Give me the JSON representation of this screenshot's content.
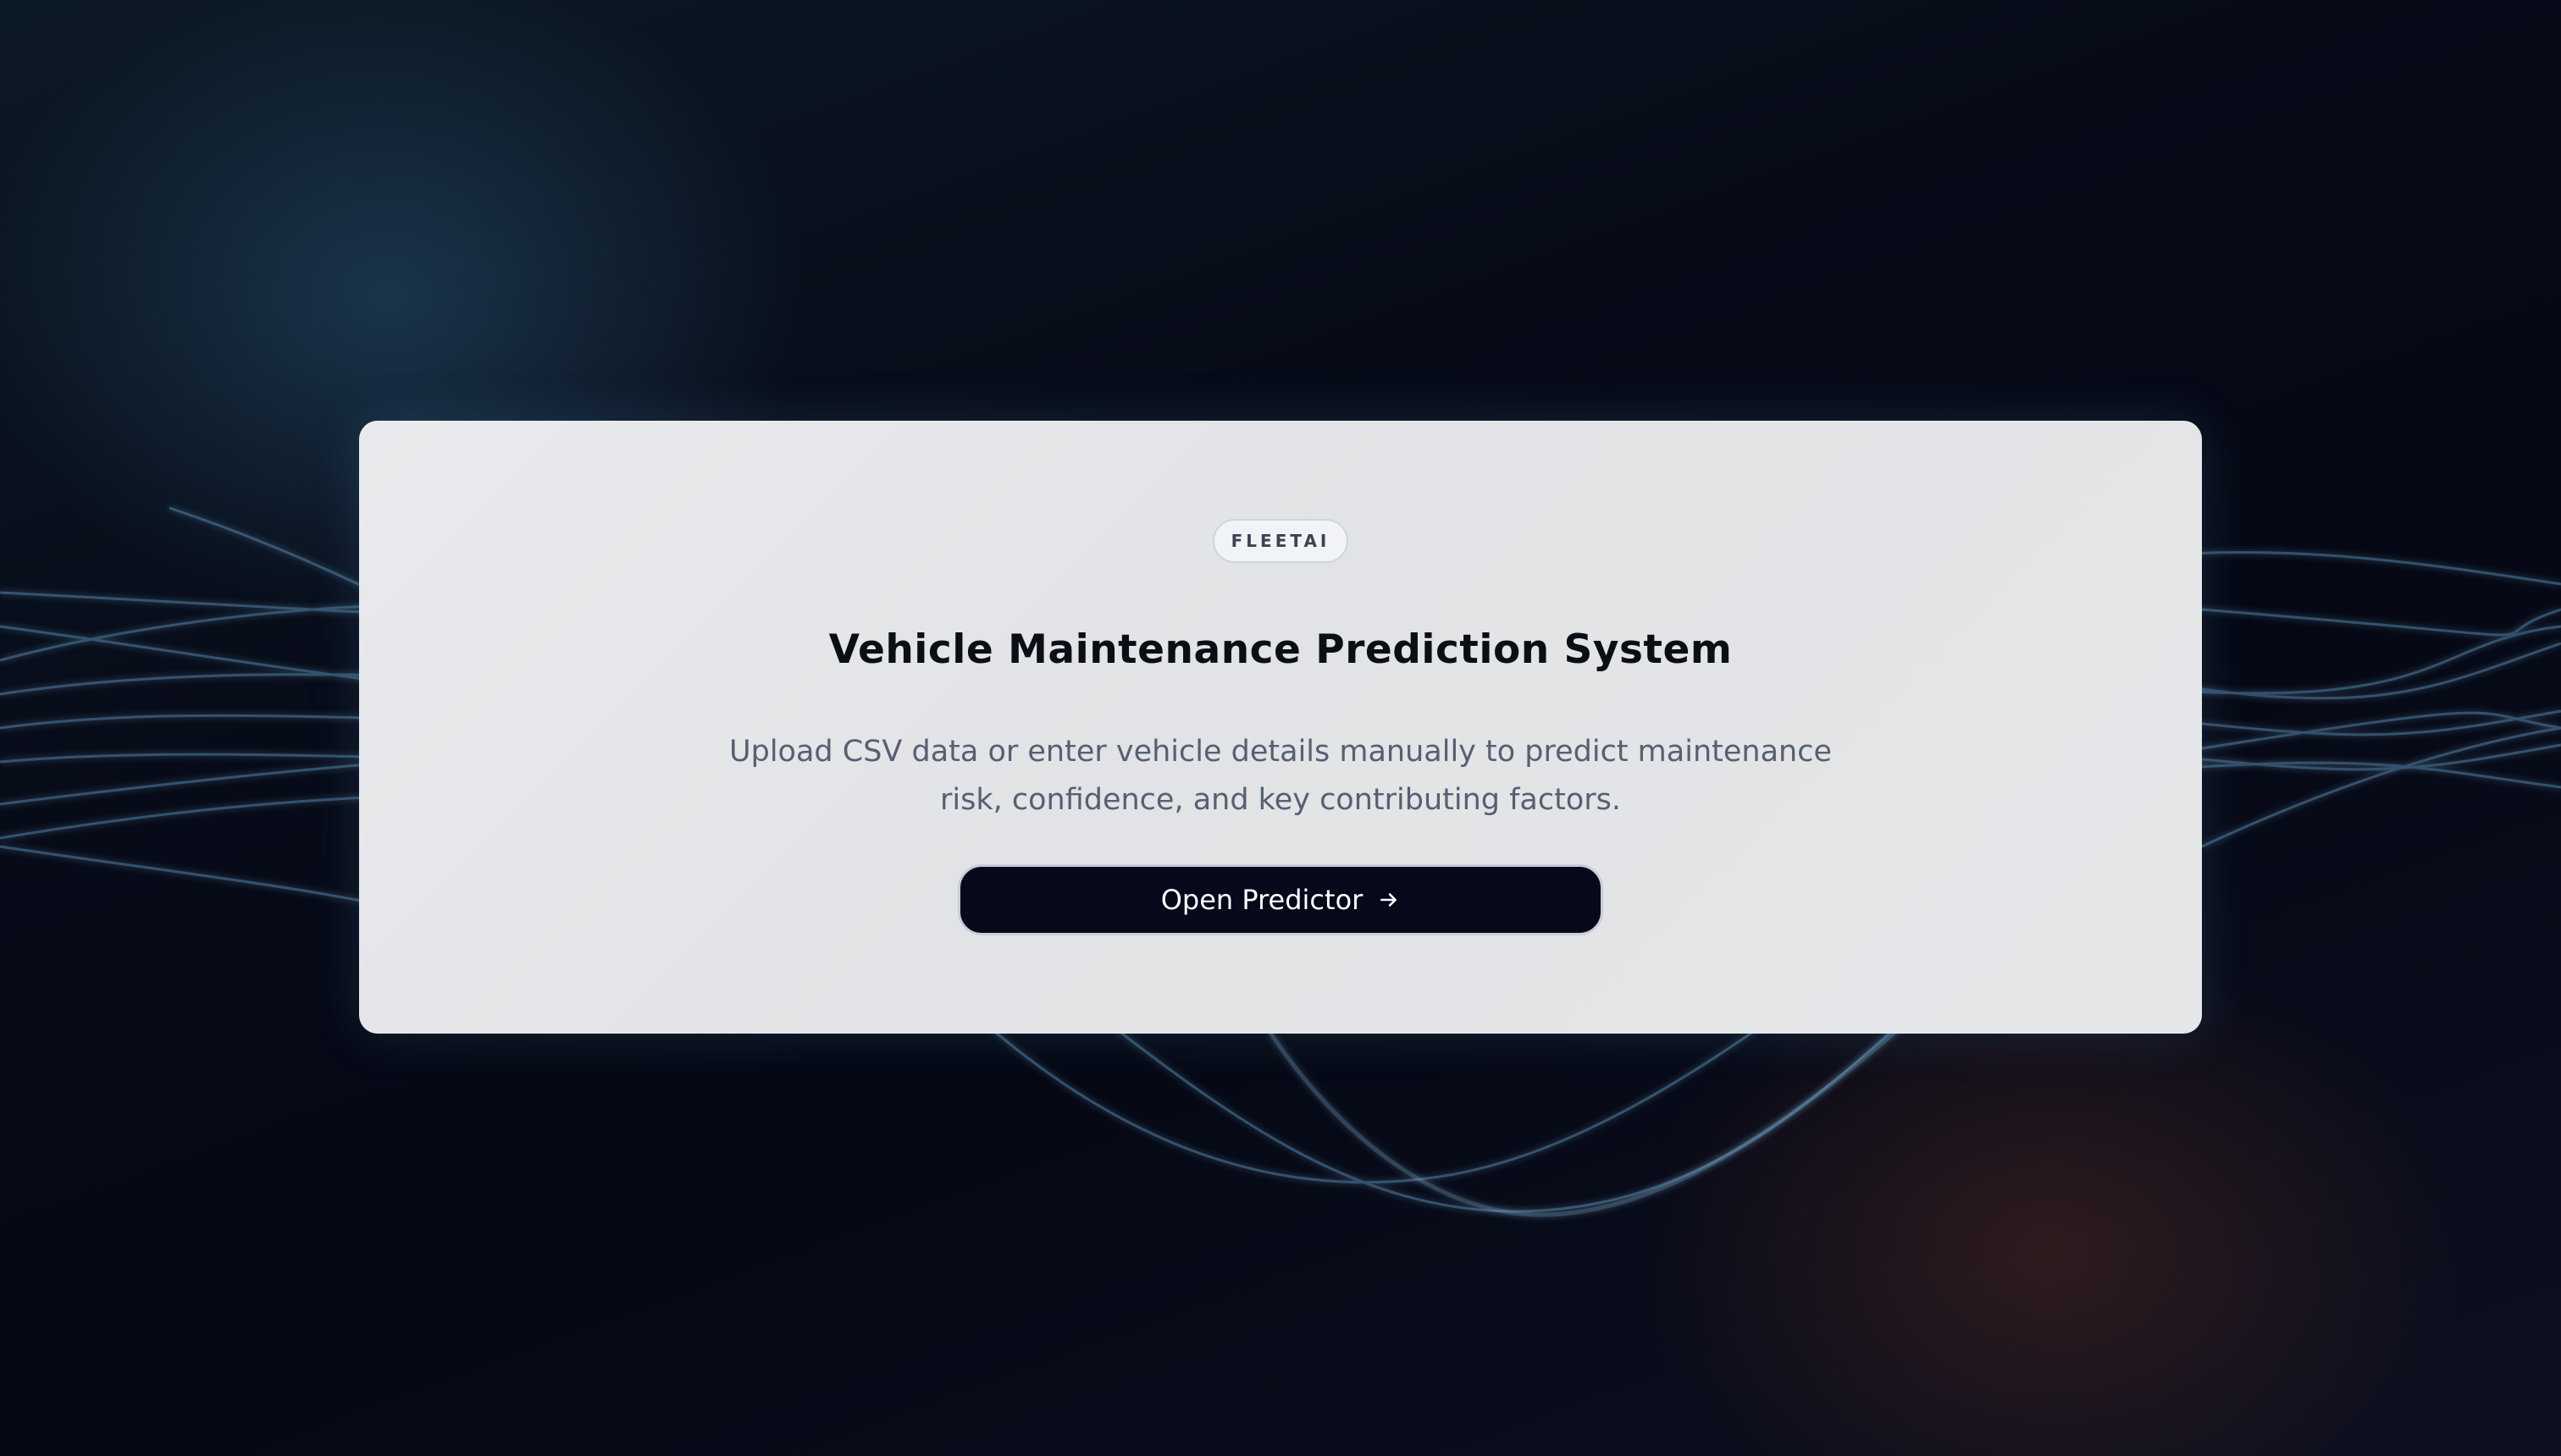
{
  "hero": {
    "badge": "FLEETAI",
    "title": "Vehicle Maintenance Prediction System",
    "subtitle": "Upload CSV data or enter vehicle details manually to predict maintenance risk, confidence, and key contributing factors.",
    "cta_label": "Open Predictor",
    "cta_icon": "arrow-right-icon"
  },
  "colors": {
    "background": "#050814",
    "card": "#e5e6e8",
    "button": "#05091a",
    "wave": "#5b8db3"
  }
}
